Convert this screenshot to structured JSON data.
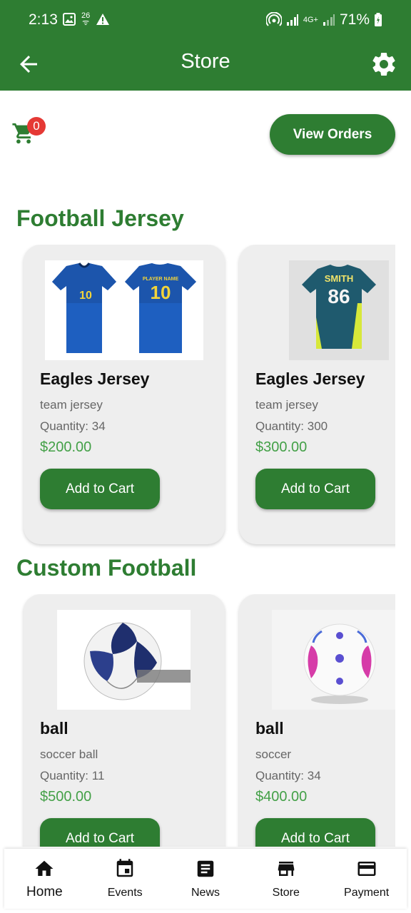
{
  "status_bar": {
    "time": "2:13",
    "small_top": "26",
    "small_bottom": "ᯤ",
    "network": "4G+",
    "battery": "71%"
  },
  "app_bar": {
    "title": "Store"
  },
  "cart": {
    "count": "0"
  },
  "view_orders_label": "View Orders",
  "sections": [
    {
      "title": "Football Jersey",
      "products": [
        {
          "name": "Eagles Jersey",
          "description": "team jersey",
          "quantity": "Quantity: 34",
          "price": "$200.00",
          "button": "Add to Cart"
        },
        {
          "name": "Eagles Jersey",
          "description": "team jersey",
          "quantity": "Quantity: 300",
          "price": "$300.00",
          "button": "Add to Cart"
        }
      ]
    },
    {
      "title": "Custom Football",
      "products": [
        {
          "name": "ball",
          "description": "soccer ball",
          "quantity": "Quantity: 11",
          "price": "$500.00",
          "button": "Add to Cart"
        },
        {
          "name": "ball",
          "description": "soccer",
          "quantity": "Quantity: 34",
          "price": "$400.00",
          "button": "Add to Cart"
        }
      ]
    }
  ],
  "jersey_prints": {
    "number_front": "10",
    "number_back": "10",
    "player_name": "PLAYER NAME",
    "smith_name": "SMITH",
    "smith_number": "86"
  },
  "bottom_nav": [
    {
      "label": "Home",
      "icon": "home-icon",
      "active": true
    },
    {
      "label": "Events",
      "icon": "calendar-icon",
      "active": false
    },
    {
      "label": "News",
      "icon": "news-icon",
      "active": false
    },
    {
      "label": "Store",
      "icon": "store-icon",
      "active": false
    },
    {
      "label": "Payment",
      "icon": "credit-card-icon",
      "active": false
    }
  ],
  "colors": {
    "primary": "#2e7d32",
    "price": "#43a047",
    "badge": "#e53935",
    "card": "#eeeeee"
  }
}
